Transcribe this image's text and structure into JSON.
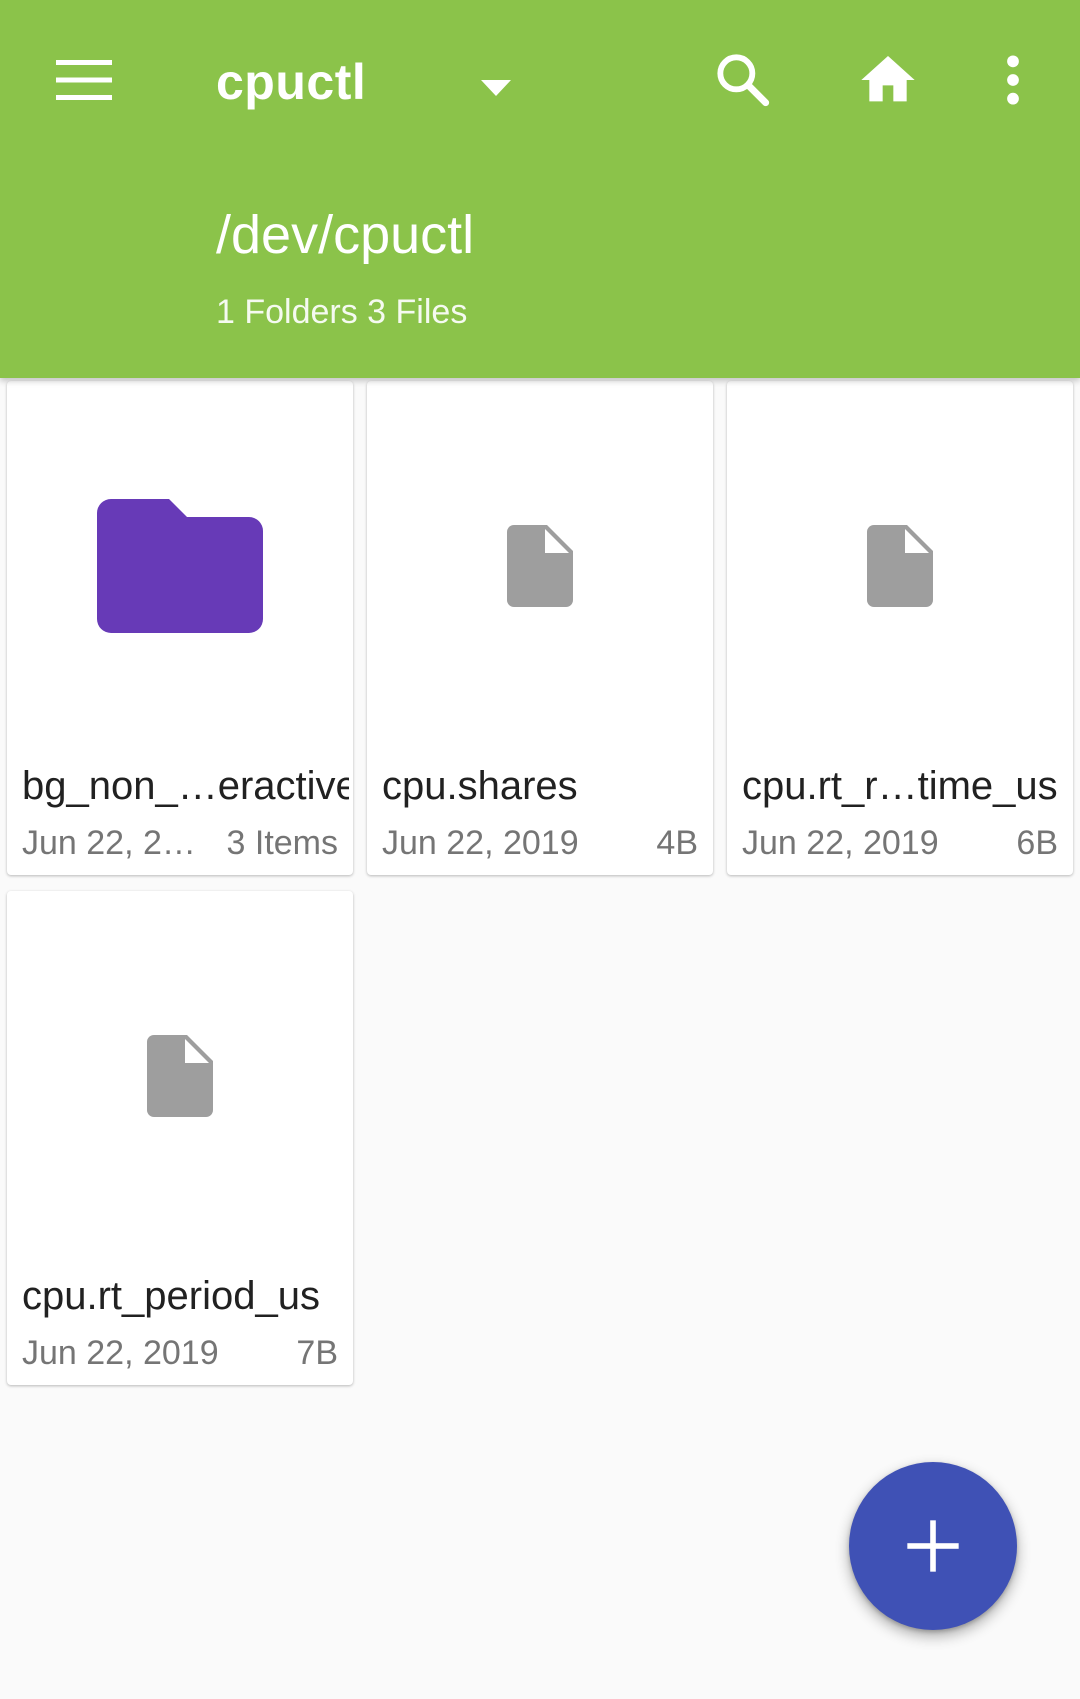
{
  "appbar": {
    "title": "cpuctl",
    "path": "/dev/cpuctl",
    "summary": "1 Folders 3 Files",
    "background_color": "#8bc34a",
    "icons": {
      "menu": "hamburger-menu-icon",
      "dropdown": "dropdown-arrow-icon",
      "search": "search-icon",
      "home": "home-icon",
      "more": "more-vert-icon"
    }
  },
  "items": [
    {
      "type": "folder",
      "name": "bg_non_…eractive",
      "date": "Jun 22, 2…",
      "size": "3 Items",
      "icon": "folder-icon",
      "icon_color": "#673ab7"
    },
    {
      "type": "file",
      "name": "cpu.shares",
      "date": "Jun 22, 2019",
      "size": "4B",
      "icon": "file-icon",
      "icon_color": "#9e9e9e"
    },
    {
      "type": "file",
      "name": "cpu.rt_r…time_us",
      "date": "Jun 22, 2019",
      "size": "6B",
      "icon": "file-icon",
      "icon_color": "#9e9e9e"
    },
    {
      "type": "file",
      "name": "cpu.rt_period_us",
      "date": "Jun 22, 2019",
      "size": "7B",
      "icon": "file-icon",
      "icon_color": "#9e9e9e"
    }
  ],
  "fab": {
    "icon": "plus-icon",
    "color": "#3f51b5"
  }
}
